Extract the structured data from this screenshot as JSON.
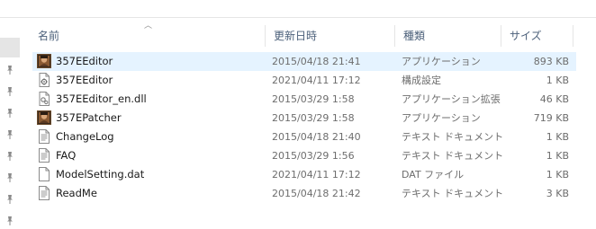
{
  "columns": {
    "name": "名前",
    "date": "更新日時",
    "type": "種類",
    "size": "サイズ"
  },
  "sort": {
    "column": "name",
    "direction": "ascending"
  },
  "files": [
    {
      "name": "357EEditor",
      "date": "2015/04/18 21:41",
      "type": "アプリケーション",
      "size": "893 KB",
      "icon": "app-portrait-icon",
      "selected": true
    },
    {
      "name": "357EEditor",
      "date": "2021/04/11 17:12",
      "type": "構成設定",
      "size": "1 KB",
      "icon": "config-file-icon"
    },
    {
      "name": "357EEditor_en.dll",
      "date": "2015/03/29 1:58",
      "type": "アプリケーション拡張",
      "size": "46 KB",
      "icon": "dll-file-icon"
    },
    {
      "name": "357EPatcher",
      "date": "2015/03/29 1:58",
      "type": "アプリケーション",
      "size": "719 KB",
      "icon": "app-portrait-icon"
    },
    {
      "name": "ChangeLog",
      "date": "2015/04/18 21:40",
      "type": "テキスト ドキュメント",
      "size": "1 KB",
      "icon": "text-document-icon"
    },
    {
      "name": "FAQ",
      "date": "2015/03/29 1:56",
      "type": "テキスト ドキュメント",
      "size": "1 KB",
      "icon": "text-document-icon"
    },
    {
      "name": "ModelSetting.dat",
      "date": "2021/04/11 17:12",
      "type": "DAT ファイル",
      "size": "1 KB",
      "icon": "blank-file-icon"
    },
    {
      "name": "ReadMe",
      "date": "2015/04/18 21:42",
      "type": "テキスト ドキュメント",
      "size": "3 KB",
      "icon": "text-document-icon"
    }
  ],
  "nav_pane": {
    "pinned_count": 8,
    "pin_icon": "pin-icon"
  },
  "colors": {
    "selected_row": "#e5f3ff",
    "header_text": "#4c607a",
    "secondary_text": "#6d6d6d",
    "separator": "#e5e5e5"
  }
}
